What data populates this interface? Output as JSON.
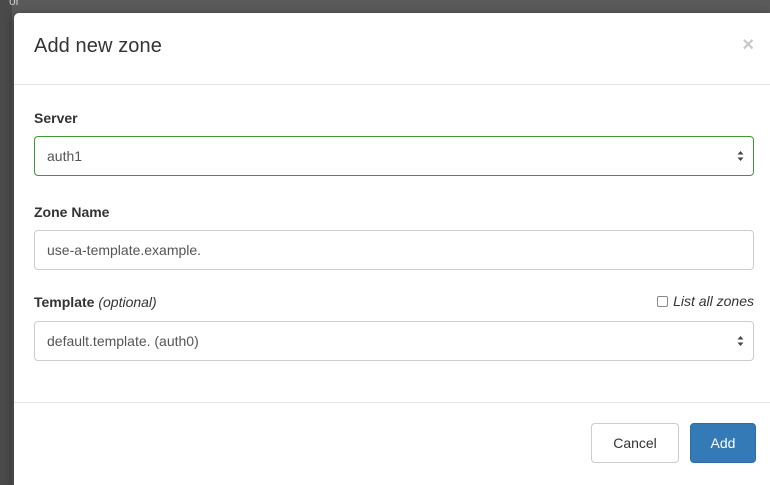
{
  "backdrop": {
    "partial_text": "or"
  },
  "modal": {
    "title": "Add new zone",
    "close_symbol": "×",
    "server": {
      "label": "Server",
      "selected": "auth1"
    },
    "zone_name": {
      "label": "Zone Name",
      "value": "use-a-template.example."
    },
    "template": {
      "label": "Template",
      "hint": "(optional)",
      "selected": "default.template. (auth0)",
      "list_all_label": "List all zones",
      "list_all_checked": false
    },
    "footer": {
      "cancel_label": "Cancel",
      "add_label": "Add"
    }
  },
  "colors": {
    "primary": "#337ab7",
    "valid_border": "#3c9a36"
  }
}
